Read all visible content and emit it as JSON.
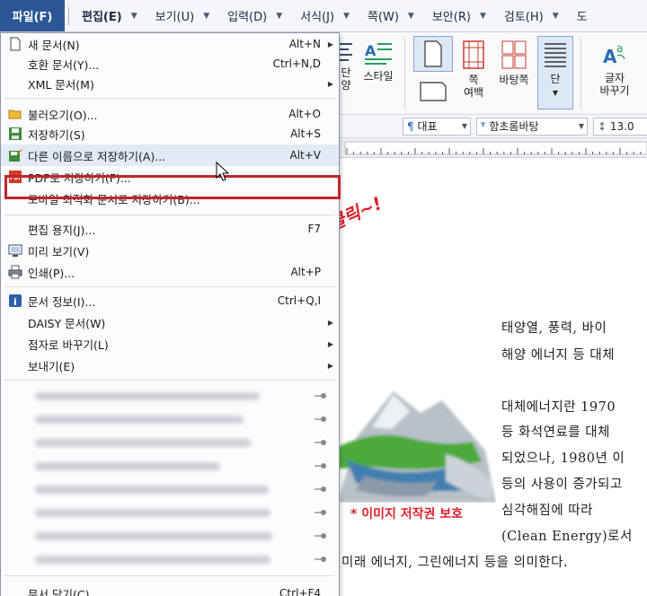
{
  "menubar": {
    "items": [
      {
        "label": "파일(F)"
      },
      {
        "label": "편집(E)"
      },
      {
        "label": "보기(U)"
      },
      {
        "label": "입력(D)"
      },
      {
        "label": "서식(J)"
      },
      {
        "label": "쪽(W)"
      },
      {
        "label": "보안(R)"
      },
      {
        "label": "검토(H)"
      },
      {
        "label": "도"
      }
    ]
  },
  "ribbon": {
    "dan_yang": "단\n양",
    "style_label": "스타일",
    "margin_label": "쪽\n여백",
    "background_label": "바탕쪽",
    "columns_label": "단",
    "change_char_label": "글자\n바꾸기"
  },
  "format_toolbar": {
    "style_value": "대표",
    "font_value": "함초롬바탕",
    "size_value": "13.0"
  },
  "file_menu": {
    "groups": [
      [
        {
          "label": "새 문서(N)",
          "shortcut": "Alt+N",
          "submenu": true,
          "icon": "new-doc-icon"
        },
        {
          "label": "호환 문서(Y)...",
          "shortcut": "Ctrl+N,D",
          "submenu": false,
          "icon": ""
        },
        {
          "label": "XML 문서(M)",
          "shortcut": "",
          "submenu": true,
          "icon": ""
        }
      ],
      [
        {
          "label": "불러오기(O)...",
          "shortcut": "Alt+O",
          "submenu": false,
          "icon": "folder-icon"
        },
        {
          "label": "저장하기(S)",
          "shortcut": "Alt+S",
          "submenu": false,
          "icon": "save-icon"
        },
        {
          "label": "다른 이름으로 저장하기(A)...",
          "shortcut": "Alt+V",
          "submenu": false,
          "icon": "save-as-icon"
        },
        {
          "label": "PDF로 저장하기(F)...",
          "shortcut": "",
          "submenu": false,
          "icon": "pdf-icon"
        },
        {
          "label": "모바일 최적화 문서로 저장하기(B)...",
          "shortcut": "",
          "submenu": false,
          "icon": ""
        }
      ],
      [
        {
          "label": "편집 용지(J)...",
          "shortcut": "F7",
          "submenu": false,
          "icon": ""
        },
        {
          "label": "미리 보기(V)",
          "shortcut": "",
          "submenu": false,
          "icon": "preview-icon"
        },
        {
          "label": "인쇄(P)...",
          "shortcut": "Alt+P",
          "submenu": false,
          "icon": "print-icon"
        }
      ],
      [
        {
          "label": "문서 정보(I)...",
          "shortcut": "Ctrl+Q,I",
          "submenu": false,
          "icon": "info-icon"
        },
        {
          "label": "DAISY 문서(W)",
          "shortcut": "",
          "submenu": true,
          "icon": ""
        },
        {
          "label": "점자로 바꾸기(L)",
          "shortcut": "",
          "submenu": true,
          "icon": ""
        },
        {
          "label": "보내기(E)",
          "shortcut": "",
          "submenu": true,
          "icon": ""
        }
      ]
    ],
    "close_item": {
      "label": "문서 닫기(C)",
      "shortcut": "Ctrl+F4"
    }
  },
  "document": {
    "lines": [
      "태양열, 풍력, 바이",
      "해양 에너지 등 대체",
      "대체에너지란  1970",
      "등 화석연료를 대체",
      "되었으나, 1980년 이",
      "등의 사용이 증가되고",
      "심각해짐에   따라",
      "(Clean  Energy)로서",
      "미래 에너지, 그린에너지 등을 의미한다."
    ],
    "annotation": "클릭~!",
    "copyright_note": "* 이미지 저작권 보호"
  },
  "colors": {
    "highlight_border": "#c0262b",
    "file_menu_bg": "#2b5797",
    "annotation": "#e0202a"
  }
}
